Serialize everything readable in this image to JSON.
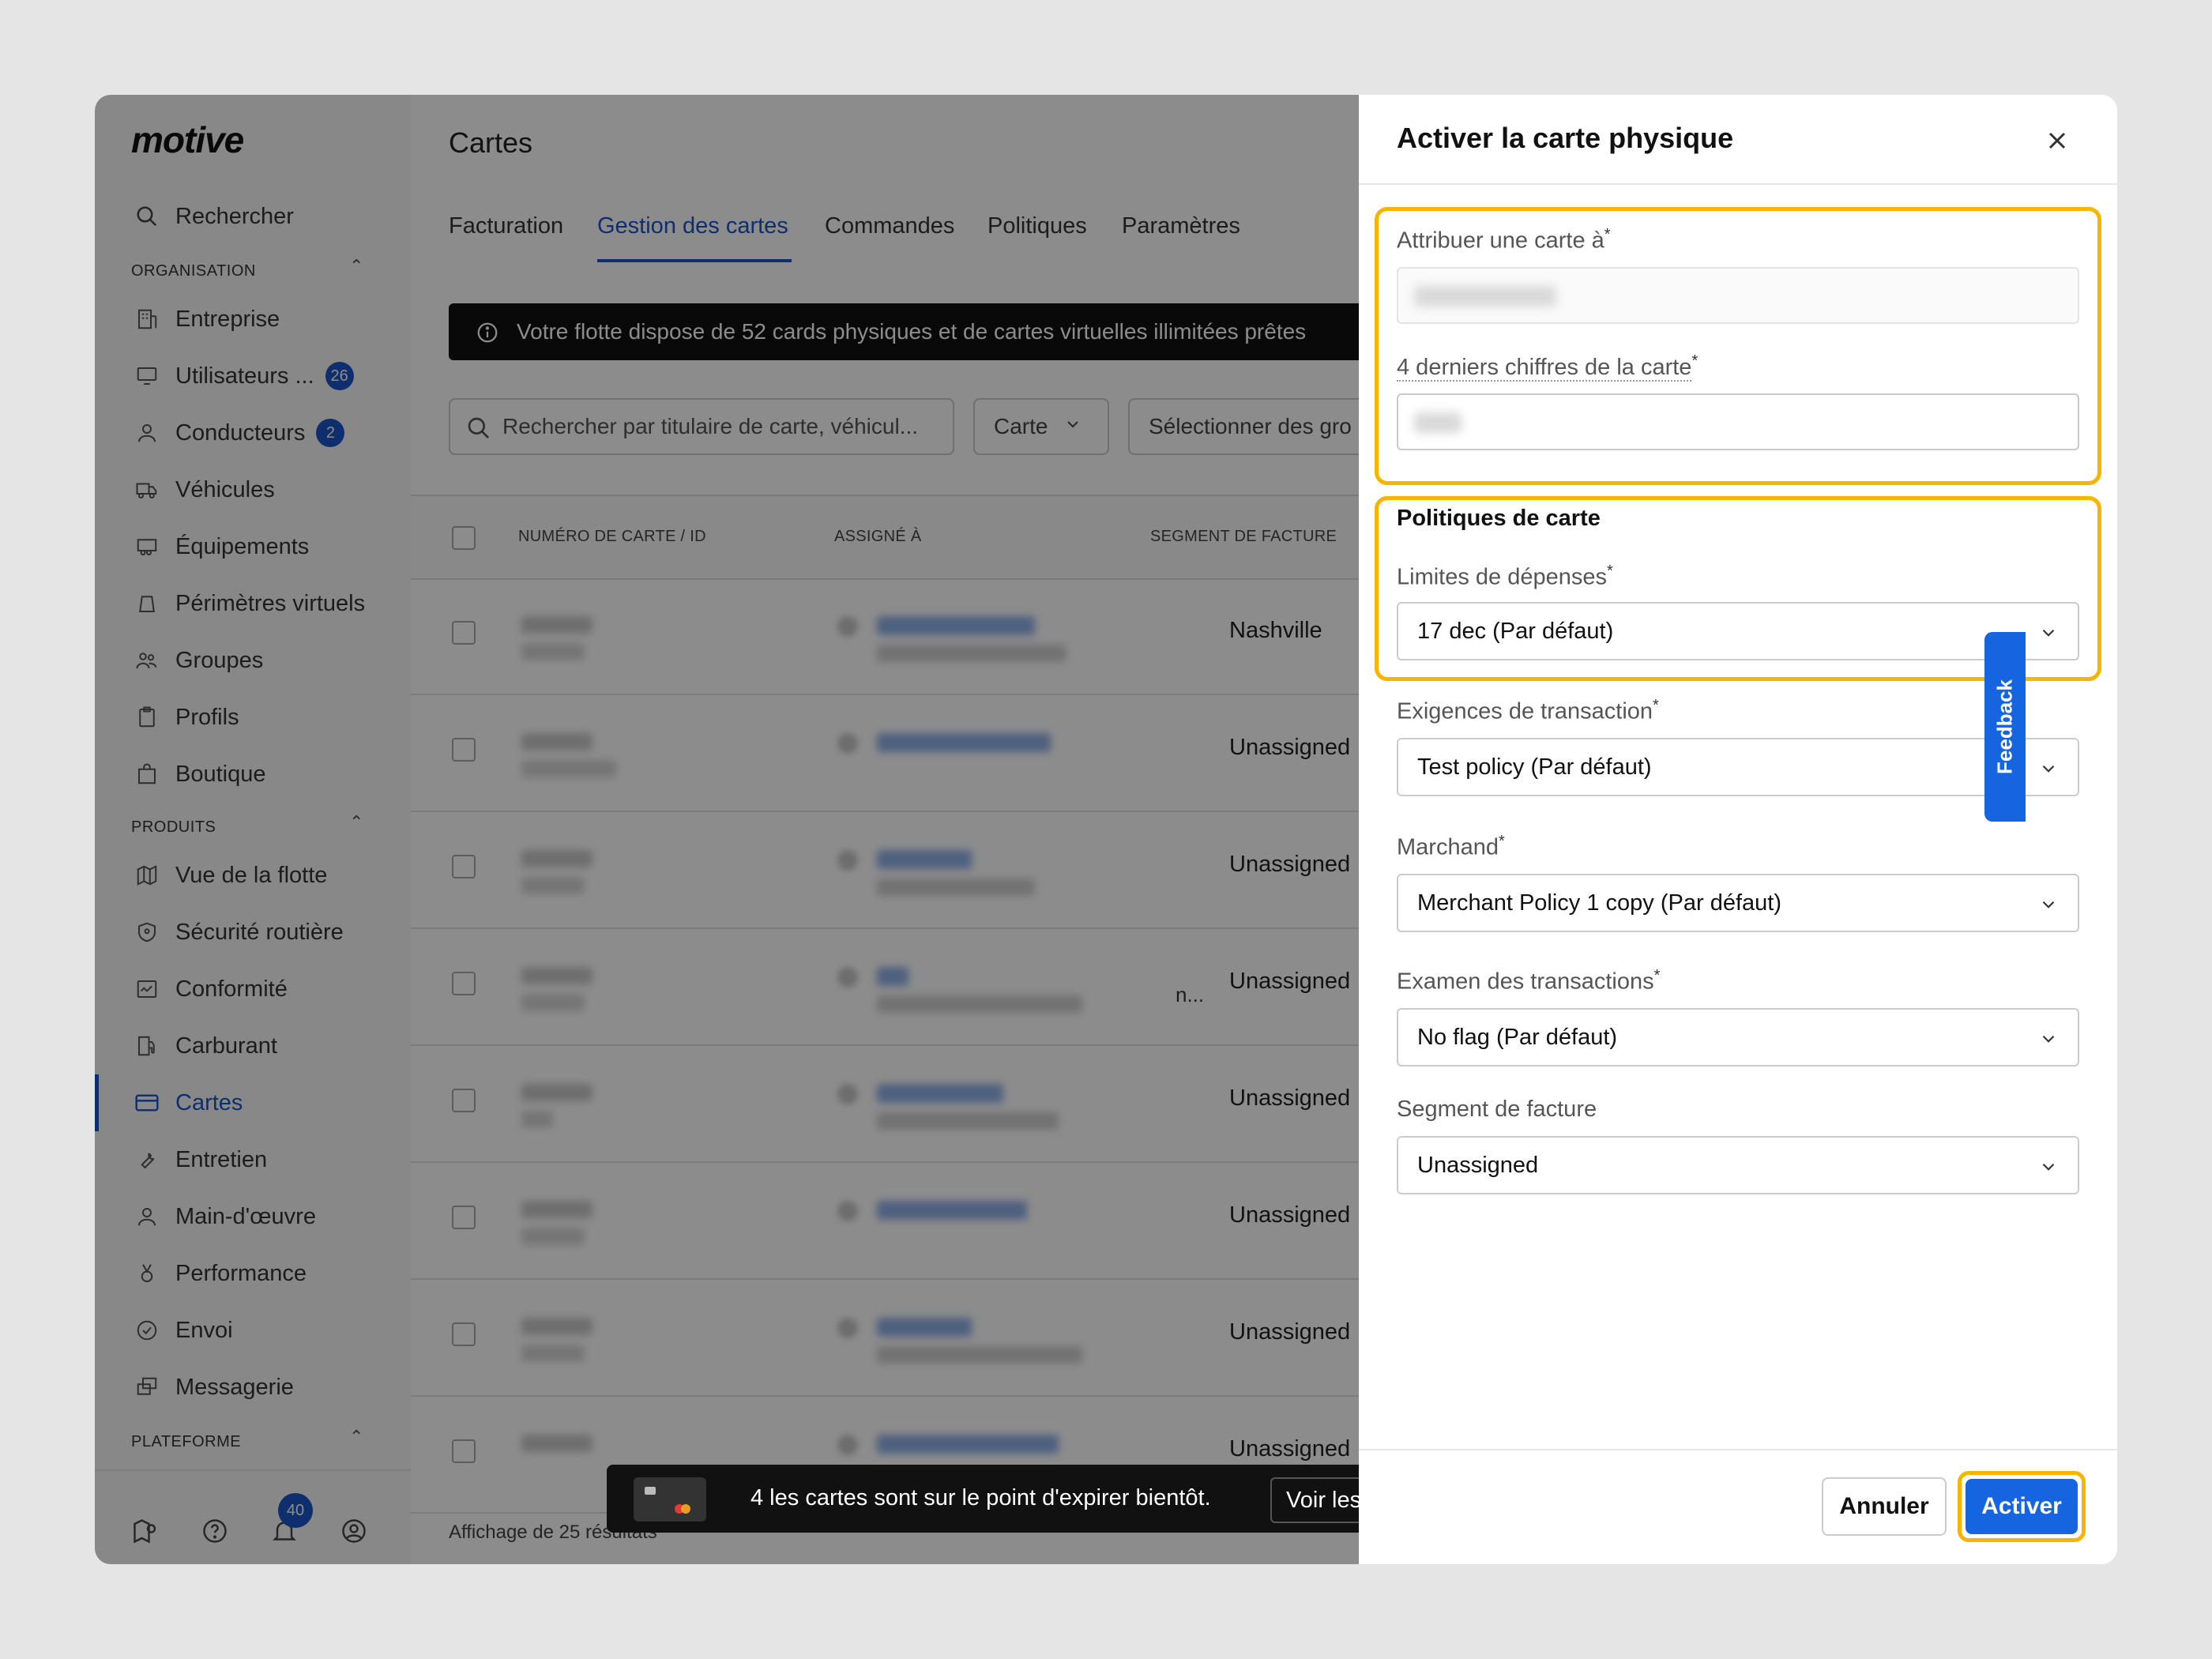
{
  "sidebar": {
    "logo": "motive",
    "search": "Rechercher",
    "section_org": "ORGANISATION",
    "section_products": "PRODUITS",
    "section_platform": "PLATEFORME",
    "org_items": [
      {
        "label": "Entreprise"
      },
      {
        "label": "Utilisateurs ...",
        "badge": "26"
      },
      {
        "label": "Conducteurs",
        "badge": "2"
      },
      {
        "label": "Véhicules"
      },
      {
        "label": "Équipements"
      },
      {
        "label": "Périmètres virtuels"
      },
      {
        "label": "Groupes"
      },
      {
        "label": "Profils"
      },
      {
        "label": "Boutique"
      }
    ],
    "product_items": [
      {
        "label": "Vue de la flotte"
      },
      {
        "label": "Sécurité routière"
      },
      {
        "label": "Conformité"
      },
      {
        "label": "Carburant"
      },
      {
        "label": "Cartes"
      },
      {
        "label": "Entretien"
      },
      {
        "label": "Main-d'œuvre"
      },
      {
        "label": "Performance"
      },
      {
        "label": "Envoi"
      },
      {
        "label": "Messagerie"
      }
    ],
    "notif_badge": "40"
  },
  "main": {
    "title": "Cartes",
    "tabs": [
      "Facturation",
      "Gestion des cartes",
      "Commandes",
      "Politiques",
      "Paramètres"
    ],
    "banner": "Votre flotte dispose de 52 cards physiques et de cartes virtuelles illimitées prêtes",
    "search_placeholder": "Rechercher par titulaire de carte, véhicul...",
    "filter_card": "Carte",
    "filter_groups": "Sélectionner des gro",
    "columns": [
      "NUMÉRO DE CARTE / ID",
      "ASSIGNÉ À",
      "SEGMENT DE FACTURE"
    ],
    "rows": [
      {
        "segment": "Nashville"
      },
      {
        "segment": "Unassigned"
      },
      {
        "segment": "Unassigned"
      },
      {
        "segment": "Unassigned"
      },
      {
        "segment": "Unassigned"
      },
      {
        "segment": "Unassigned"
      },
      {
        "segment": "Unassigned"
      },
      {
        "segment": "Unassigned"
      }
    ],
    "truncation": "n...",
    "results": "Affichage de 25 résultats",
    "toast_text": "4 les cartes sont sur le point d'expirer bientôt.",
    "toast_button": "Voir les"
  },
  "drawer": {
    "title": "Activer la carte physique",
    "assign_label": "Attribuer une carte à",
    "last4_label": "4 derniers chiffres de la carte",
    "policies_title": "Politiques de carte",
    "spend_label": "Limites de dépenses",
    "spend_value": "17 dec (Par défaut)",
    "txn_req_label": "Exigences de transaction",
    "txn_req_value": "Test policy (Par défaut)",
    "merchant_label": "Marchand",
    "merchant_value": "Merchant Policy 1 copy (Par défaut)",
    "review_label": "Examen des transactions",
    "review_value": "No flag (Par défaut)",
    "segment_label": "Segment de facture",
    "segment_value": "Unassigned",
    "cancel": "Annuler",
    "activate": "Activer",
    "required_mark": "*"
  },
  "feedback": "Feedback",
  "colors": {
    "accent": "#1565e0",
    "highlight": "#f7b500"
  }
}
